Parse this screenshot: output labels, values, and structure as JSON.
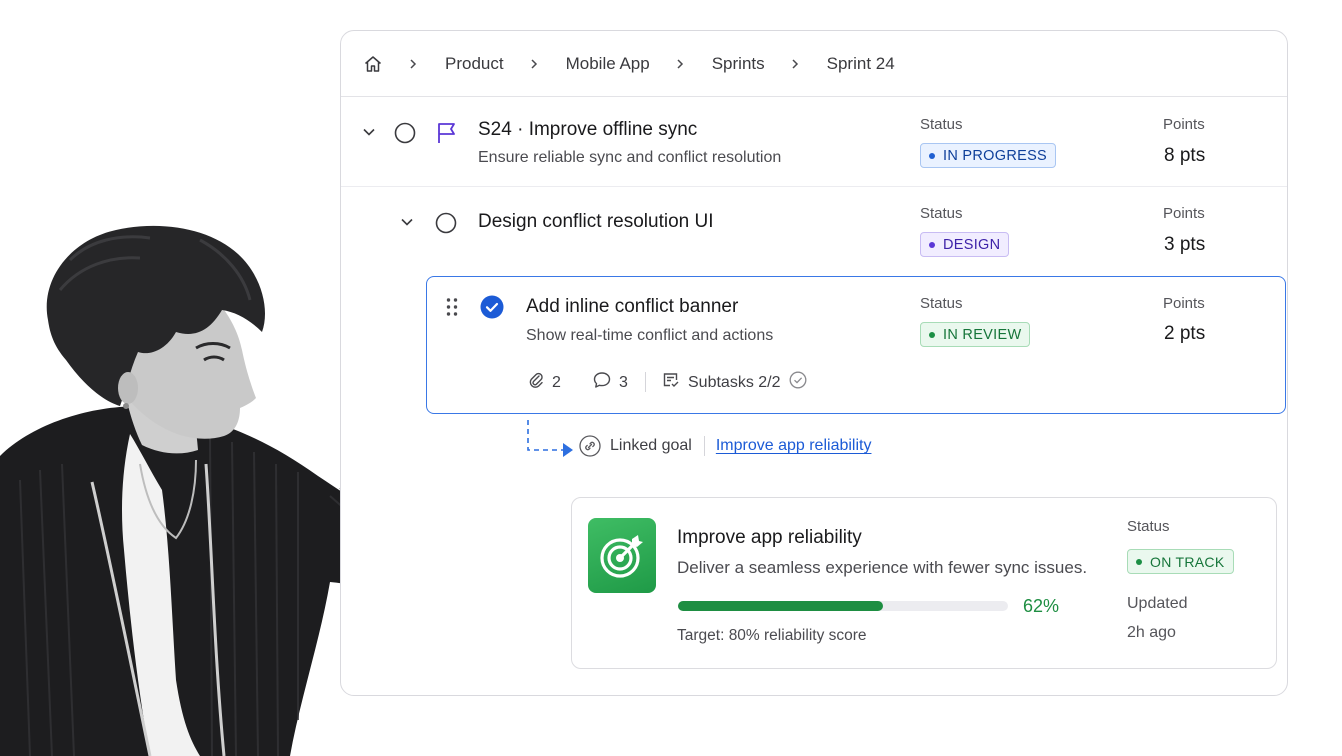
{
  "breadcrumb": {
    "items": [
      "Product",
      "Mobile App",
      "Sprints",
      "Sprint 24"
    ]
  },
  "epic": {
    "title": "S24 · Improve offline sync",
    "subtitle": "Ensure reliable sync and conflict resolution",
    "status_label": "Status",
    "status": "IN PROGRESS",
    "points_label": "Points",
    "points": "8 pts"
  },
  "story": {
    "title": "Design conflict resolution UI",
    "status_label": "Status",
    "status": "DESIGN",
    "points_label": "Points",
    "points": "3 pts"
  },
  "task": {
    "title": "Add inline conflict banner",
    "subtitle": "Show real-time conflict and actions",
    "status_label": "Status",
    "status": "IN REVIEW",
    "points_label": "Points",
    "points": "2 pts",
    "attachments": "2",
    "comments": "3",
    "subtasks": "Subtasks 2/2"
  },
  "linked": {
    "label": "Linked goal",
    "goal_link": "Improve app reliability"
  },
  "goal": {
    "title": "Improve app reliability",
    "description": "Deliver a seamless experience with fewer sync issues.",
    "progress": 0.62,
    "progress_text": "62%",
    "target": "Target: 80% reliability score",
    "status_label": "Status",
    "status": "ON TRACK",
    "updated_label": "Updated",
    "updated": "2h ago"
  },
  "colors": {
    "accent_blue": "#3a78e6",
    "progress_green": "#1e8e42",
    "goal_icon_green": "#2aa853",
    "epic_flag_purple": "#5b37d6"
  },
  "icons": {
    "home": "home-icon",
    "separator": "chevron-right-icon",
    "collapse": "chevron-down-icon",
    "status_empty": "circle-icon",
    "status_done": "check-circle-icon",
    "epic": "flag-icon",
    "drag": "drag-handle-icon",
    "attachment": "paperclip-icon",
    "comment": "comment-icon",
    "subtask": "subtask-icon",
    "link": "link-icon",
    "goal": "target-icon"
  }
}
